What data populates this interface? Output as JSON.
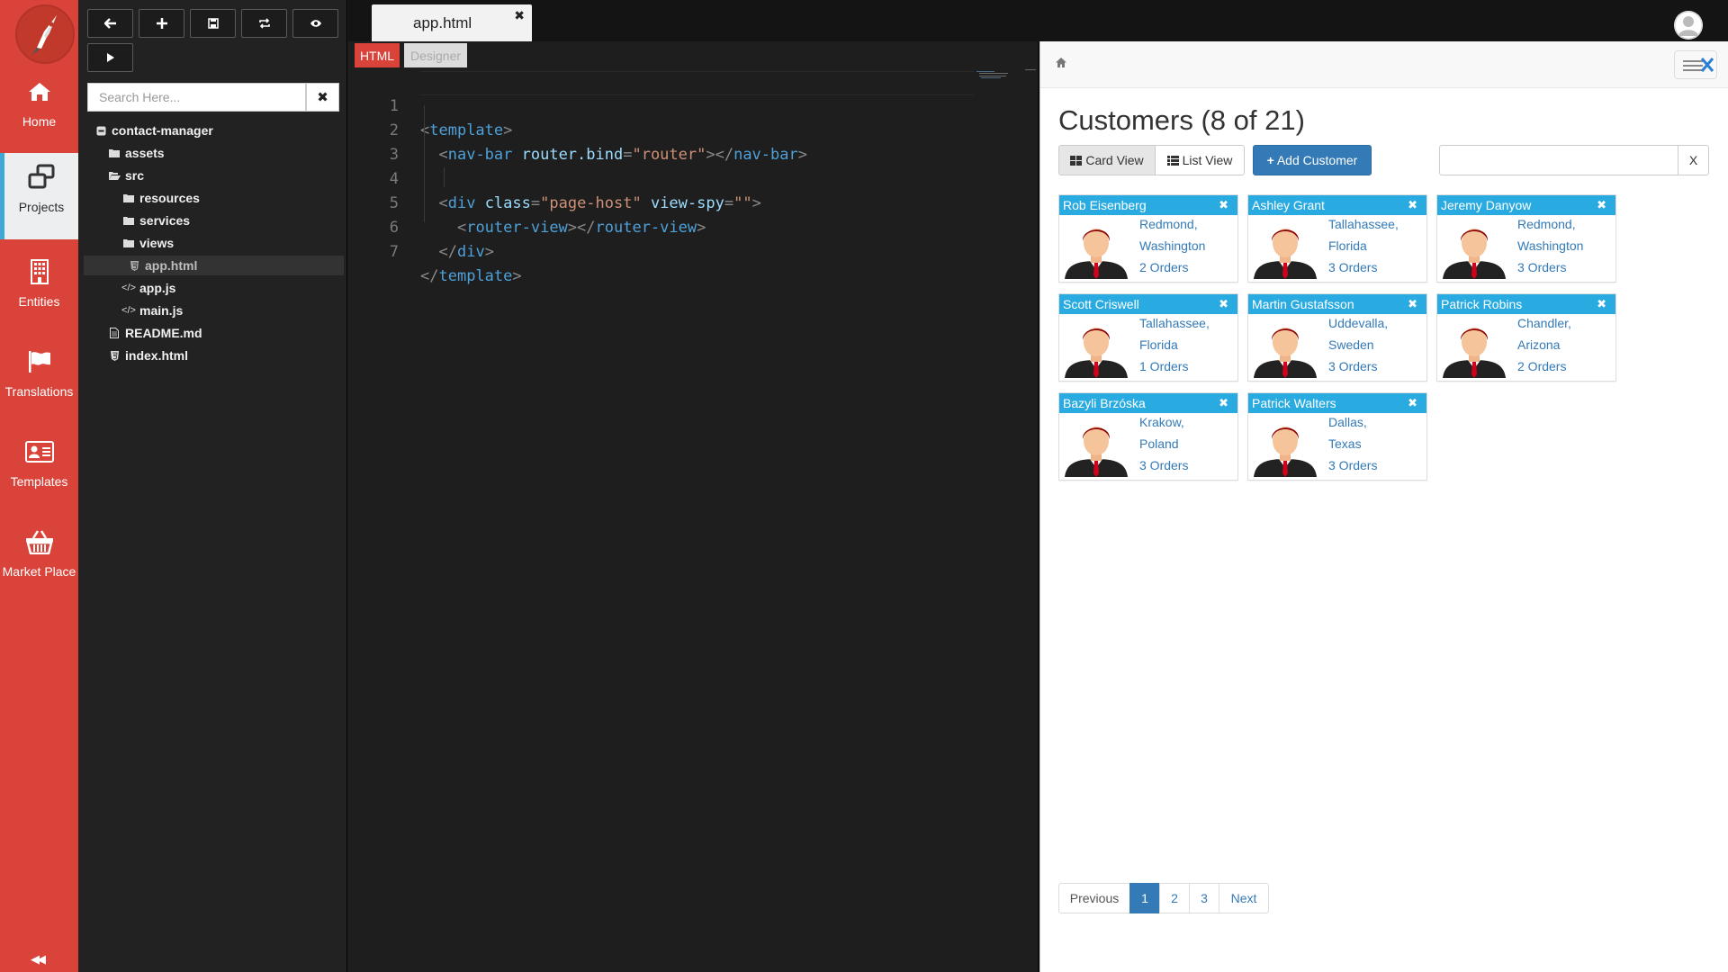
{
  "rail": {
    "items": [
      {
        "label": "Home",
        "icon": "home-icon"
      },
      {
        "label": "Projects",
        "icon": "projects-icon"
      },
      {
        "label": "Entities",
        "icon": "building-icon"
      },
      {
        "label": "Translations",
        "icon": "flag-icon"
      },
      {
        "label": "Templates",
        "icon": "id-card-icon"
      },
      {
        "label": "Market Place",
        "icon": "basket-icon"
      }
    ],
    "active": "Projects",
    "collapse_glyph": "◀◀"
  },
  "toolbar": {
    "buttons": [
      "back-icon",
      "add-icon",
      "save-icon",
      "refresh-icon",
      "preview-icon",
      "run-icon"
    ]
  },
  "tree": {
    "search_placeholder": "Search Here...",
    "clear_glyph": "✖",
    "items": [
      {
        "label": "contact-manager",
        "type": "folder-open-root"
      },
      {
        "label": "assets",
        "type": "folder"
      },
      {
        "label": "src",
        "type": "folder-open"
      },
      {
        "label": "resources",
        "type": "folder"
      },
      {
        "label": "services",
        "type": "folder"
      },
      {
        "label": "views",
        "type": "folder"
      },
      {
        "label": "app.html",
        "type": "html-file",
        "selected": true
      },
      {
        "label": "app.js",
        "type": "code-file"
      },
      {
        "label": "main.js",
        "type": "code-file"
      },
      {
        "label": "README.md",
        "type": "file"
      },
      {
        "label": "index.html",
        "type": "html-file"
      }
    ]
  },
  "editor": {
    "tab_label": "app.html",
    "tab_close": "✖",
    "modes": {
      "html": "HTML",
      "designer": "Designer"
    },
    "lines": [
      {
        "n": "1",
        "a": "<",
        "b": "template",
        "c": ">"
      },
      {
        "n": "2",
        "indent": "  ",
        "pre": "<",
        "tag": "nav-bar",
        "attr": " router.bind",
        "eq": "=",
        "val": "\"router\"",
        "mid": "></",
        "tag2": "nav-bar",
        "end": ">"
      },
      {
        "n": "3"
      },
      {
        "n": "4",
        "indent": "  ",
        "pre": "<",
        "tag": "div",
        "attr": " class",
        "eq": "=",
        "val": "\"page-host\"",
        "attr2": " view-spy",
        "eq2": "=",
        "val2": "\"\"",
        "end": ">"
      },
      {
        "n": "5",
        "indent": "    ",
        "pre": "<",
        "tag": "router-view",
        "mid": "></",
        "tag2": "router-view",
        "end": ">"
      },
      {
        "n": "6",
        "indent": "  ",
        "pre": "</",
        "tag": "div",
        "end": ">"
      },
      {
        "n": "7",
        "pre": "</",
        "tag": "template",
        "end": ">"
      }
    ]
  },
  "preview": {
    "title": "Customers (8 of 21)",
    "card_view_label": "Card View",
    "list_view_label": "List View",
    "add_label": "Add Customer",
    "add_glyph": "+",
    "filter_clear": "X",
    "customers": [
      {
        "name": "Rob Eisenberg",
        "city": "Redmond,",
        "region": "Washington",
        "orders": "2 Orders"
      },
      {
        "name": "Ashley Grant",
        "city": "Tallahassee,",
        "region": "Florida",
        "orders": "3 Orders"
      },
      {
        "name": "Jeremy Danyow",
        "city": "Redmond,",
        "region": "Washington",
        "orders": "3 Orders"
      },
      {
        "name": "Scott Criswell",
        "city": "Tallahassee,",
        "region": "Florida",
        "orders": "1 Orders"
      },
      {
        "name": "Martin Gustafsson",
        "city": "Uddevalla,",
        "region": "Sweden",
        "orders": "3 Orders"
      },
      {
        "name": "Patrick Robins",
        "city": "Chandler,",
        "region": "Arizona",
        "orders": "2 Orders"
      },
      {
        "name": "Bazyli Brzóska",
        "city": "Krakow,",
        "region": "Poland",
        "orders": "3 Orders"
      },
      {
        "name": "Patrick Walters",
        "city": "Dallas,",
        "region": "Texas",
        "orders": "3 Orders"
      }
    ],
    "card_close": "✖",
    "pager": {
      "previous": "Previous",
      "pages": [
        "1",
        "2",
        "3"
      ],
      "current": "1",
      "next": "Next"
    }
  },
  "colors": {
    "accent_red": "#d9433a",
    "card_header": "#29abe2",
    "primary": "#337ab7"
  }
}
